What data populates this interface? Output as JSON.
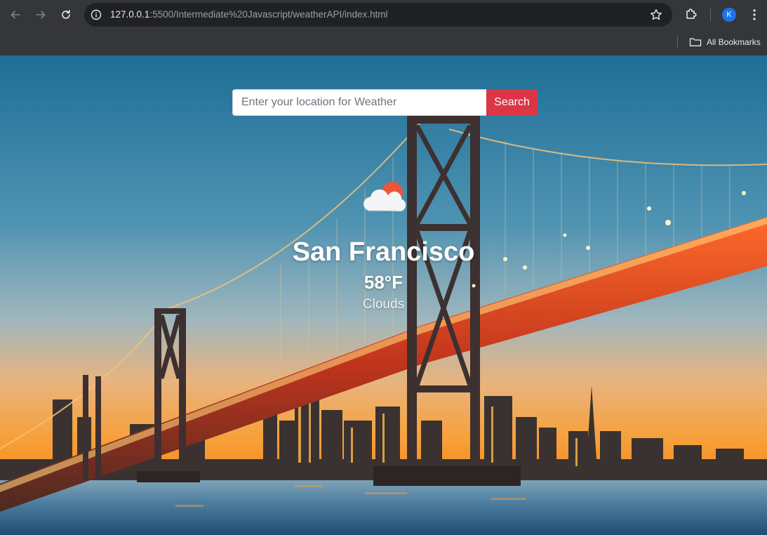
{
  "browser": {
    "url_host": "127.0.0.1",
    "url_rest": ":5500/Intermediate%20Javascript/weatherAPI/index.html",
    "avatar_letter": "K",
    "bookmarks_label": "All Bookmarks"
  },
  "search": {
    "placeholder": "Enter your location for Weather",
    "value": "",
    "button_label": "Search"
  },
  "weather": {
    "icon": "partly-cloudy-icon",
    "city": "San Francisco",
    "temperature": "58°F",
    "condition": "Clouds"
  },
  "colors": {
    "search_button": "#dc3545",
    "chrome_bg": "#35363a",
    "omnibox_bg": "#202124",
    "sun": "#e8573a"
  }
}
